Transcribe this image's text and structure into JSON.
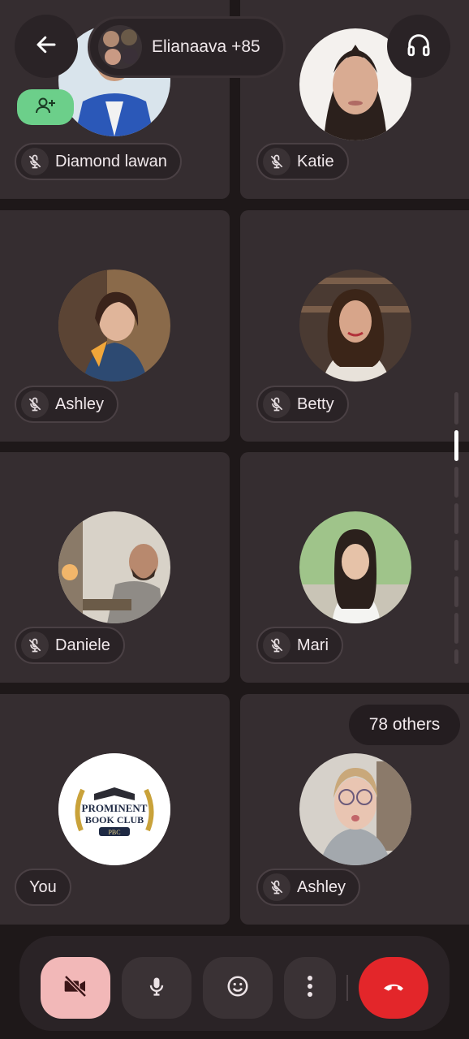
{
  "header": {
    "title": "Elianaava +85"
  },
  "participants": [
    {
      "name": "Diamond lawan",
      "muted": true
    },
    {
      "name": "Katie",
      "muted": true
    },
    {
      "name": "Ashley",
      "muted": true
    },
    {
      "name": "Betty",
      "muted": true
    },
    {
      "name": "Daniele",
      "muted": true
    },
    {
      "name": "Mari",
      "muted": true
    },
    {
      "name": "You",
      "muted": false
    },
    {
      "name": "Ashley",
      "muted": true
    }
  ],
  "others_badge": "78 others",
  "self_avatar": {
    "line1": "PROMINENT",
    "line2": "BOOK CLUB",
    "line3": "PBC"
  },
  "colors": {
    "background": "#1e1819",
    "tile": "#352d30",
    "add_person_green": "#6ccf8a",
    "camera_off_pink": "#f2b8b8",
    "end_call_red": "#e3262a"
  },
  "icons": [
    "back-arrow-icon",
    "headphones-icon",
    "add-person-icon",
    "mic-off-icon",
    "camera-off-icon",
    "mic-icon",
    "emoji-icon",
    "more-vert-icon",
    "end-call-icon"
  ]
}
